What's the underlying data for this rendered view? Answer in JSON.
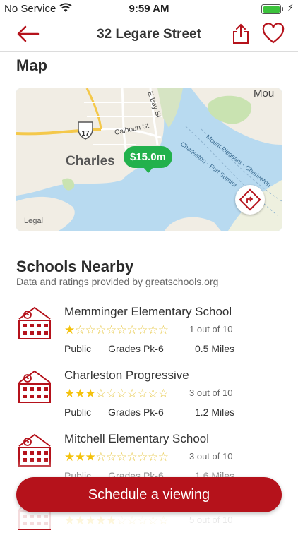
{
  "status_bar": {
    "carrier": "No Service",
    "time": "9:59 AM"
  },
  "nav": {
    "title": "32 Legare Street"
  },
  "map_section": {
    "title": "Map",
    "price": "$15.0m",
    "legal": "Legal",
    "labels": [
      "Charles",
      "Calhoun St",
      "E Bay St",
      "Charleston - Fort Sumter",
      "Mount Pleasant - Charleston",
      "Mou",
      "17"
    ]
  },
  "schools": {
    "title": "Schools Nearby",
    "subtitle": "Data and ratings provided by greatschools.org",
    "items": [
      {
        "name": "Memminger Elementary School",
        "rating": 1,
        "rating_text": "1 out of 10",
        "type": "Public",
        "grades": "Grades Pk-6",
        "distance": "0.5 Miles"
      },
      {
        "name": "Charleston Progressive",
        "rating": 3,
        "rating_text": "3 out of 10",
        "type": "Public",
        "grades": "Grades Pk-6",
        "distance": "1.2 Miles"
      },
      {
        "name": "Mitchell Elementary School",
        "rating": 3,
        "rating_text": "3 out of 10",
        "type": "Public",
        "grades": "Grades Pk-6",
        "distance": "1.6 Miles"
      },
      {
        "name": "",
        "rating": 5,
        "rating_text": "5 out of 10",
        "type": "",
        "grades": "",
        "distance": ""
      }
    ]
  },
  "cta": {
    "label": "Schedule a viewing"
  },
  "colors": {
    "brand": "#b5121b",
    "price_pin": "#22b14c",
    "star": "#f4c20d"
  },
  "icons": [
    "wifi-icon",
    "battery-icon",
    "back-arrow-icon",
    "share-icon",
    "heart-icon",
    "directions-icon",
    "school-building-icon"
  ]
}
